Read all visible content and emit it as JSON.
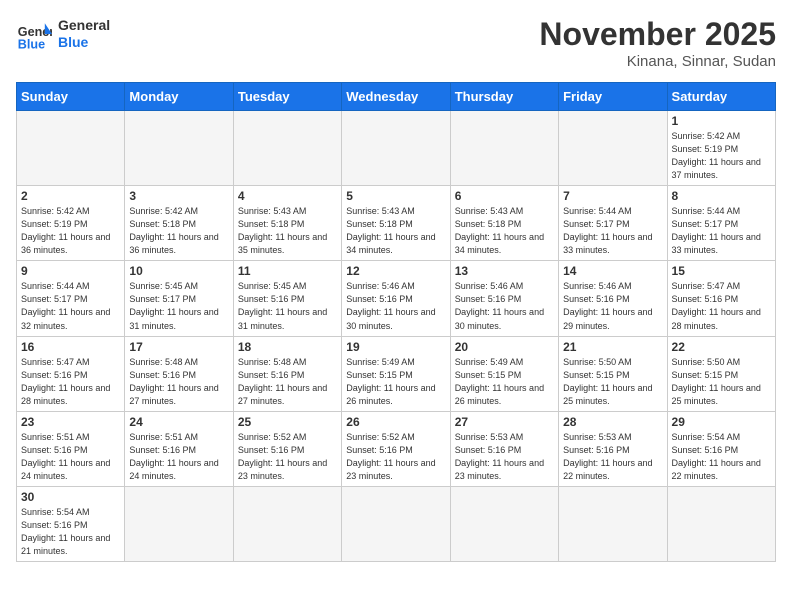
{
  "header": {
    "logo_general": "General",
    "logo_blue": "Blue",
    "month_title": "November 2025",
    "subtitle": "Kinana, Sinnar, Sudan"
  },
  "weekdays": [
    "Sunday",
    "Monday",
    "Tuesday",
    "Wednesday",
    "Thursday",
    "Friday",
    "Saturday"
  ],
  "weeks": [
    [
      {
        "day": "",
        "empty": true
      },
      {
        "day": "",
        "empty": true
      },
      {
        "day": "",
        "empty": true
      },
      {
        "day": "",
        "empty": true
      },
      {
        "day": "",
        "empty": true
      },
      {
        "day": "",
        "empty": true
      },
      {
        "day": "1",
        "sunrise": "5:42 AM",
        "sunset": "5:19 PM",
        "daylight": "11 hours and 37 minutes."
      }
    ],
    [
      {
        "day": "2",
        "sunrise": "5:42 AM",
        "sunset": "5:19 PM",
        "daylight": "11 hours and 36 minutes."
      },
      {
        "day": "3",
        "sunrise": "5:42 AM",
        "sunset": "5:18 PM",
        "daylight": "11 hours and 36 minutes."
      },
      {
        "day": "4",
        "sunrise": "5:43 AM",
        "sunset": "5:18 PM",
        "daylight": "11 hours and 35 minutes."
      },
      {
        "day": "5",
        "sunrise": "5:43 AM",
        "sunset": "5:18 PM",
        "daylight": "11 hours and 34 minutes."
      },
      {
        "day": "6",
        "sunrise": "5:43 AM",
        "sunset": "5:18 PM",
        "daylight": "11 hours and 34 minutes."
      },
      {
        "day": "7",
        "sunrise": "5:44 AM",
        "sunset": "5:17 PM",
        "daylight": "11 hours and 33 minutes."
      },
      {
        "day": "8",
        "sunrise": "5:44 AM",
        "sunset": "5:17 PM",
        "daylight": "11 hours and 33 minutes."
      }
    ],
    [
      {
        "day": "9",
        "sunrise": "5:44 AM",
        "sunset": "5:17 PM",
        "daylight": "11 hours and 32 minutes."
      },
      {
        "day": "10",
        "sunrise": "5:45 AM",
        "sunset": "5:17 PM",
        "daylight": "11 hours and 31 minutes."
      },
      {
        "day": "11",
        "sunrise": "5:45 AM",
        "sunset": "5:16 PM",
        "daylight": "11 hours and 31 minutes."
      },
      {
        "day": "12",
        "sunrise": "5:46 AM",
        "sunset": "5:16 PM",
        "daylight": "11 hours and 30 minutes."
      },
      {
        "day": "13",
        "sunrise": "5:46 AM",
        "sunset": "5:16 PM",
        "daylight": "11 hours and 30 minutes."
      },
      {
        "day": "14",
        "sunrise": "5:46 AM",
        "sunset": "5:16 PM",
        "daylight": "11 hours and 29 minutes."
      },
      {
        "day": "15",
        "sunrise": "5:47 AM",
        "sunset": "5:16 PM",
        "daylight": "11 hours and 28 minutes."
      }
    ],
    [
      {
        "day": "16",
        "sunrise": "5:47 AM",
        "sunset": "5:16 PM",
        "daylight": "11 hours and 28 minutes."
      },
      {
        "day": "17",
        "sunrise": "5:48 AM",
        "sunset": "5:16 PM",
        "daylight": "11 hours and 27 minutes."
      },
      {
        "day": "18",
        "sunrise": "5:48 AM",
        "sunset": "5:16 PM",
        "daylight": "11 hours and 27 minutes."
      },
      {
        "day": "19",
        "sunrise": "5:49 AM",
        "sunset": "5:15 PM",
        "daylight": "11 hours and 26 minutes."
      },
      {
        "day": "20",
        "sunrise": "5:49 AM",
        "sunset": "5:15 PM",
        "daylight": "11 hours and 26 minutes."
      },
      {
        "day": "21",
        "sunrise": "5:50 AM",
        "sunset": "5:15 PM",
        "daylight": "11 hours and 25 minutes."
      },
      {
        "day": "22",
        "sunrise": "5:50 AM",
        "sunset": "5:15 PM",
        "daylight": "11 hours and 25 minutes."
      }
    ],
    [
      {
        "day": "23",
        "sunrise": "5:51 AM",
        "sunset": "5:16 PM",
        "daylight": "11 hours and 24 minutes."
      },
      {
        "day": "24",
        "sunrise": "5:51 AM",
        "sunset": "5:16 PM",
        "daylight": "11 hours and 24 minutes."
      },
      {
        "day": "25",
        "sunrise": "5:52 AM",
        "sunset": "5:16 PM",
        "daylight": "11 hours and 23 minutes."
      },
      {
        "day": "26",
        "sunrise": "5:52 AM",
        "sunset": "5:16 PM",
        "daylight": "11 hours and 23 minutes."
      },
      {
        "day": "27",
        "sunrise": "5:53 AM",
        "sunset": "5:16 PM",
        "daylight": "11 hours and 23 minutes."
      },
      {
        "day": "28",
        "sunrise": "5:53 AM",
        "sunset": "5:16 PM",
        "daylight": "11 hours and 22 minutes."
      },
      {
        "day": "29",
        "sunrise": "5:54 AM",
        "sunset": "5:16 PM",
        "daylight": "11 hours and 22 minutes."
      }
    ],
    [
      {
        "day": "30",
        "sunrise": "5:54 AM",
        "sunset": "5:16 PM",
        "daylight": "11 hours and 21 minutes."
      },
      {
        "day": "",
        "empty": true
      },
      {
        "day": "",
        "empty": true
      },
      {
        "day": "",
        "empty": true
      },
      {
        "day": "",
        "empty": true
      },
      {
        "day": "",
        "empty": true
      },
      {
        "day": "",
        "empty": true
      }
    ]
  ],
  "labels": {
    "sunrise": "Sunrise: ",
    "sunset": "Sunset: ",
    "daylight": "Daylight: "
  }
}
